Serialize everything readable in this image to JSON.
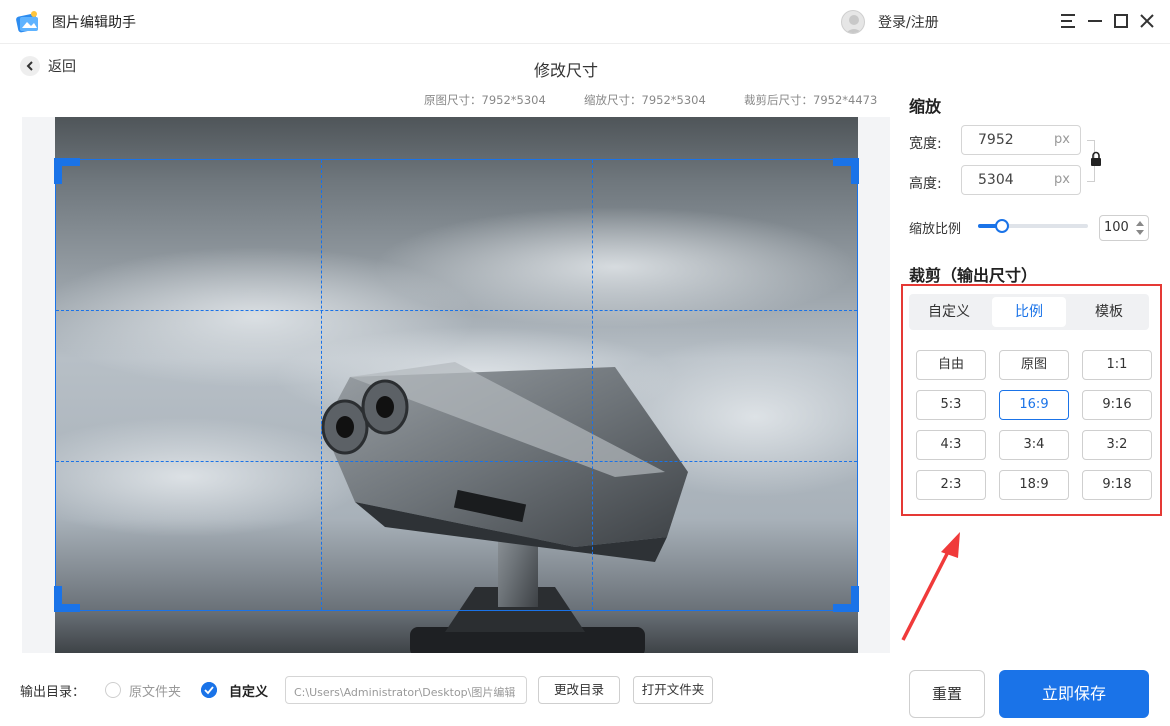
{
  "app": {
    "title": "图片编辑助手",
    "login_label": "登录/注册"
  },
  "nav": {
    "back_label": "返回",
    "page_title": "修改尺寸"
  },
  "size_info": {
    "original": "原图尺寸：7952*5304",
    "scaled": "缩放尺寸：7952*5304",
    "cropped": "裁剪后尺寸：7952*4473"
  },
  "scale": {
    "title": "缩放",
    "width_label": "宽度:",
    "width_value": "7952",
    "height_label": "高度:",
    "height_value": "5304",
    "unit": "px",
    "ratio_label": "缩放比例",
    "ratio_value": "100",
    "slider_fraction": 0.22,
    "aspect_locked": true
  },
  "crop": {
    "title": "裁剪（输出尺寸）",
    "tabs": [
      "自定义",
      "比例",
      "模板"
    ],
    "active_tab": "比例",
    "ratios": [
      "自由",
      "原图",
      "1:1",
      "5:3",
      "16:9",
      "9:16",
      "4:3",
      "3:4",
      "3:2",
      "2:3",
      "18:9",
      "9:18"
    ],
    "selected_ratio": "16:9"
  },
  "output": {
    "label": "输出目录：",
    "option_original": "原文件夹",
    "option_custom": "自定义",
    "selected": "自定义",
    "path": "C:\\Users\\Administrator\\Desktop\\图片编辑",
    "change_dir_label": "更改目录",
    "open_folder_label": "打开文件夹"
  },
  "actions": {
    "reset_label": "重置",
    "save_label": "立即保存"
  },
  "colors": {
    "accent": "#1a73e8",
    "highlight_frame": "#e53935",
    "arrow": "#f03a3a"
  }
}
